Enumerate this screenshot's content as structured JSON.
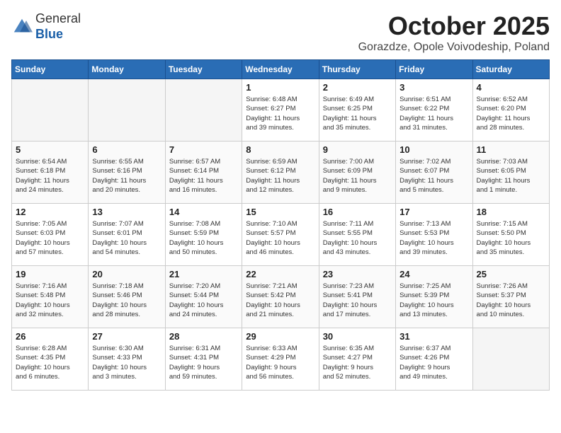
{
  "header": {
    "logo_line1": "General",
    "logo_line2": "Blue",
    "month": "October 2025",
    "location": "Gorazdze, Opole Voivodeship, Poland"
  },
  "weekdays": [
    "Sunday",
    "Monday",
    "Tuesday",
    "Wednesday",
    "Thursday",
    "Friday",
    "Saturday"
  ],
  "weeks": [
    [
      {
        "day": "",
        "info": ""
      },
      {
        "day": "",
        "info": ""
      },
      {
        "day": "",
        "info": ""
      },
      {
        "day": "1",
        "info": "Sunrise: 6:48 AM\nSunset: 6:27 PM\nDaylight: 11 hours\nand 39 minutes."
      },
      {
        "day": "2",
        "info": "Sunrise: 6:49 AM\nSunset: 6:25 PM\nDaylight: 11 hours\nand 35 minutes."
      },
      {
        "day": "3",
        "info": "Sunrise: 6:51 AM\nSunset: 6:22 PM\nDaylight: 11 hours\nand 31 minutes."
      },
      {
        "day": "4",
        "info": "Sunrise: 6:52 AM\nSunset: 6:20 PM\nDaylight: 11 hours\nand 28 minutes."
      }
    ],
    [
      {
        "day": "5",
        "info": "Sunrise: 6:54 AM\nSunset: 6:18 PM\nDaylight: 11 hours\nand 24 minutes."
      },
      {
        "day": "6",
        "info": "Sunrise: 6:55 AM\nSunset: 6:16 PM\nDaylight: 11 hours\nand 20 minutes."
      },
      {
        "day": "7",
        "info": "Sunrise: 6:57 AM\nSunset: 6:14 PM\nDaylight: 11 hours\nand 16 minutes."
      },
      {
        "day": "8",
        "info": "Sunrise: 6:59 AM\nSunset: 6:12 PM\nDaylight: 11 hours\nand 12 minutes."
      },
      {
        "day": "9",
        "info": "Sunrise: 7:00 AM\nSunset: 6:09 PM\nDaylight: 11 hours\nand 9 minutes."
      },
      {
        "day": "10",
        "info": "Sunrise: 7:02 AM\nSunset: 6:07 PM\nDaylight: 11 hours\nand 5 minutes."
      },
      {
        "day": "11",
        "info": "Sunrise: 7:03 AM\nSunset: 6:05 PM\nDaylight: 11 hours\nand 1 minute."
      }
    ],
    [
      {
        "day": "12",
        "info": "Sunrise: 7:05 AM\nSunset: 6:03 PM\nDaylight: 10 hours\nand 57 minutes."
      },
      {
        "day": "13",
        "info": "Sunrise: 7:07 AM\nSunset: 6:01 PM\nDaylight: 10 hours\nand 54 minutes."
      },
      {
        "day": "14",
        "info": "Sunrise: 7:08 AM\nSunset: 5:59 PM\nDaylight: 10 hours\nand 50 minutes."
      },
      {
        "day": "15",
        "info": "Sunrise: 7:10 AM\nSunset: 5:57 PM\nDaylight: 10 hours\nand 46 minutes."
      },
      {
        "day": "16",
        "info": "Sunrise: 7:11 AM\nSunset: 5:55 PM\nDaylight: 10 hours\nand 43 minutes."
      },
      {
        "day": "17",
        "info": "Sunrise: 7:13 AM\nSunset: 5:53 PM\nDaylight: 10 hours\nand 39 minutes."
      },
      {
        "day": "18",
        "info": "Sunrise: 7:15 AM\nSunset: 5:50 PM\nDaylight: 10 hours\nand 35 minutes."
      }
    ],
    [
      {
        "day": "19",
        "info": "Sunrise: 7:16 AM\nSunset: 5:48 PM\nDaylight: 10 hours\nand 32 minutes."
      },
      {
        "day": "20",
        "info": "Sunrise: 7:18 AM\nSunset: 5:46 PM\nDaylight: 10 hours\nand 28 minutes."
      },
      {
        "day": "21",
        "info": "Sunrise: 7:20 AM\nSunset: 5:44 PM\nDaylight: 10 hours\nand 24 minutes."
      },
      {
        "day": "22",
        "info": "Sunrise: 7:21 AM\nSunset: 5:42 PM\nDaylight: 10 hours\nand 21 minutes."
      },
      {
        "day": "23",
        "info": "Sunrise: 7:23 AM\nSunset: 5:41 PM\nDaylight: 10 hours\nand 17 minutes."
      },
      {
        "day": "24",
        "info": "Sunrise: 7:25 AM\nSunset: 5:39 PM\nDaylight: 10 hours\nand 13 minutes."
      },
      {
        "day": "25",
        "info": "Sunrise: 7:26 AM\nSunset: 5:37 PM\nDaylight: 10 hours\nand 10 minutes."
      }
    ],
    [
      {
        "day": "26",
        "info": "Sunrise: 6:28 AM\nSunset: 4:35 PM\nDaylight: 10 hours\nand 6 minutes."
      },
      {
        "day": "27",
        "info": "Sunrise: 6:30 AM\nSunset: 4:33 PM\nDaylight: 10 hours\nand 3 minutes."
      },
      {
        "day": "28",
        "info": "Sunrise: 6:31 AM\nSunset: 4:31 PM\nDaylight: 9 hours\nand 59 minutes."
      },
      {
        "day": "29",
        "info": "Sunrise: 6:33 AM\nSunset: 4:29 PM\nDaylight: 9 hours\nand 56 minutes."
      },
      {
        "day": "30",
        "info": "Sunrise: 6:35 AM\nSunset: 4:27 PM\nDaylight: 9 hours\nand 52 minutes."
      },
      {
        "day": "31",
        "info": "Sunrise: 6:37 AM\nSunset: 4:26 PM\nDaylight: 9 hours\nand 49 minutes."
      },
      {
        "day": "",
        "info": ""
      }
    ]
  ]
}
